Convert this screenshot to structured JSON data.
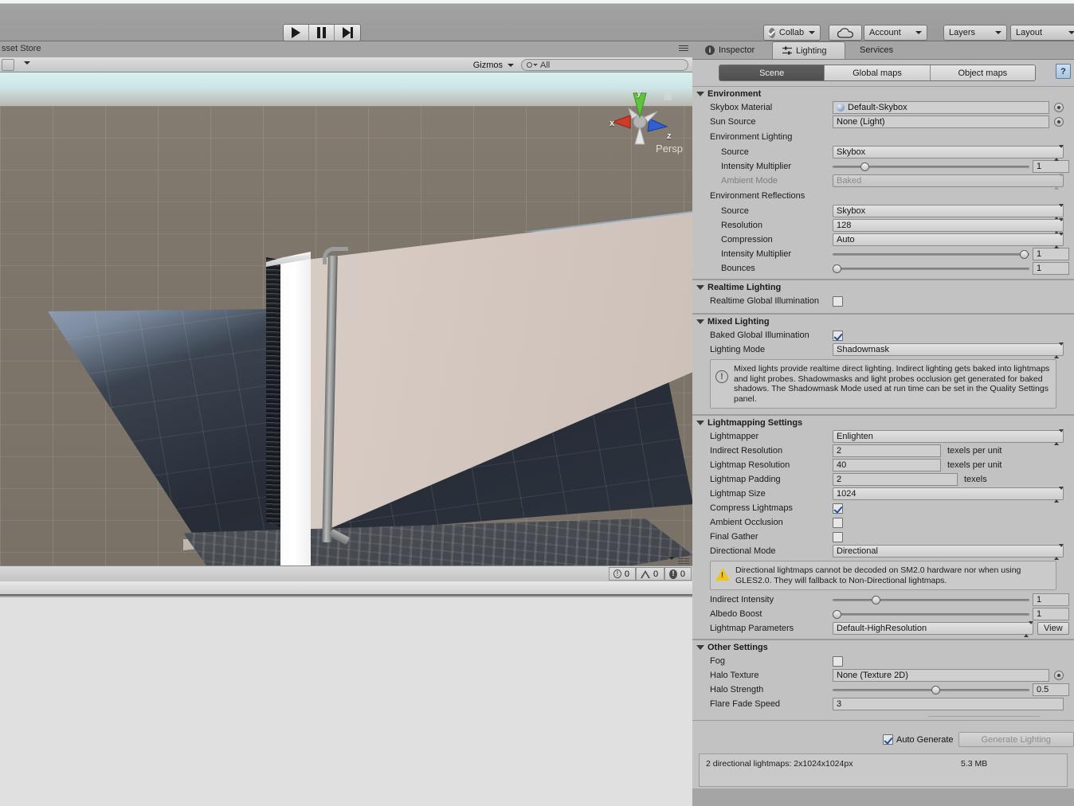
{
  "toolbar": {
    "play_label": "play-icon",
    "pause_label": "pause-icon",
    "step_label": "step-icon",
    "collab": "Collab",
    "cloud": "cloud-icon",
    "account": "Account",
    "layers": "Layers",
    "layout": "Layout"
  },
  "scene_panel": {
    "tab_label": "sset Store",
    "gizmos": "Gizmos",
    "search_value": "All",
    "view_label": "Persp",
    "axis_x": "x",
    "axis_y": "y",
    "axis_z": "z",
    "status": {
      "info_count": "0",
      "warning_count": "0",
      "error_count": "0"
    }
  },
  "inspector": {
    "tabs": [
      {
        "label": "Inspector",
        "icon": "info-icon",
        "active": false
      },
      {
        "label": "Lighting",
        "icon": "lighting-icon",
        "active": true
      },
      {
        "label": "Services",
        "icon": "",
        "active": false
      }
    ],
    "mode_tabs": [
      {
        "label": "Scene",
        "selected": true
      },
      {
        "label": "Global maps",
        "selected": false
      },
      {
        "label": "Object maps",
        "selected": false
      }
    ],
    "help_label": "?"
  },
  "environment": {
    "title": "Environment",
    "skybox_material_label": "Skybox Material",
    "skybox_material_value": "Default-Skybox",
    "sun_source_label": "Sun Source",
    "sun_source_value": "None (Light)",
    "env_lighting_label": "Environment Lighting",
    "source_label": "Source",
    "source_value": "Skybox",
    "intensity_label": "Intensity Multiplier",
    "intensity_value": "1",
    "intensity_pct": 16,
    "ambient_mode_label": "Ambient Mode",
    "ambient_mode_value": "Baked",
    "env_reflections_label": "Environment Reflections",
    "refl_source_label": "Source",
    "refl_source_value": "Skybox",
    "resolution_label": "Resolution",
    "resolution_value": "128",
    "compression_label": "Compression",
    "compression_value": "Auto",
    "refl_intensity_label": "Intensity Multiplier",
    "refl_intensity_value": "1",
    "refl_intensity_pct": 97,
    "bounces_label": "Bounces",
    "bounces_value": "1",
    "bounces_pct": 2
  },
  "realtime_lighting": {
    "title": "Realtime Lighting",
    "rtgi_label": "Realtime Global Illumination",
    "rtgi_checked": false
  },
  "mixed_lighting": {
    "title": "Mixed Lighting",
    "bgi_label": "Baked Global Illumination",
    "bgi_checked": true,
    "lighting_mode_label": "Lighting Mode",
    "lighting_mode_value": "Shadowmask",
    "info_text": "Mixed lights provide realtime direct lighting. Indirect lighting gets baked into lightmaps and light probes. Shadowmasks and light probes occlusion get generated for baked shadows. The Shadowmask Mode used at run time can be set in the Quality Settings panel."
  },
  "lightmapping": {
    "title": "Lightmapping Settings",
    "lightmapper_label": "Lightmapper",
    "lightmapper_value": "Enlighten",
    "indirect_res_label": "Indirect Resolution",
    "indirect_res_value": "2",
    "indirect_res_unit": "texels per unit",
    "lightmap_res_label": "Lightmap Resolution",
    "lightmap_res_value": "40",
    "lightmap_res_unit": "texels per unit",
    "padding_label": "Lightmap Padding",
    "padding_value": "2",
    "padding_unit": "texels",
    "size_label": "Lightmap Size",
    "size_value": "1024",
    "compress_label": "Compress Lightmaps",
    "compress_checked": true,
    "ao_label": "Ambient Occlusion",
    "ao_checked": false,
    "final_gather_label": "Final Gather",
    "final_gather_checked": false,
    "directional_mode_label": "Directional Mode",
    "directional_mode_value": "Directional",
    "warning_text": "Directional lightmaps cannot be decoded on SM2.0 hardware nor when using GLES2.0. They will fallback to Non-Directional lightmaps.",
    "indirect_intensity_label": "Indirect Intensity",
    "indirect_intensity_value": "1",
    "indirect_intensity_pct": 22,
    "albedo_boost_label": "Albedo Boost",
    "albedo_boost_value": "1",
    "albedo_boost_pct": 2,
    "lightmap_params_label": "Lightmap Parameters",
    "lightmap_params_value": "Default-HighResolution",
    "view_button": "View"
  },
  "other_settings": {
    "title": "Other Settings",
    "fog_label": "Fog",
    "fog_checked": false,
    "halo_texture_label": "Halo Texture",
    "halo_texture_value": "None (Texture 2D)",
    "halo_strength_label": "Halo Strength",
    "halo_strength_value": "0.5",
    "halo_strength_pct": 52,
    "flare_fade_label": "Flare Fade Speed",
    "flare_fade_value": "3"
  },
  "generate": {
    "auto_generate_label": "Auto Generate",
    "auto_generate_checked": true,
    "generate_button": "Generate Lighting",
    "stats_left": "2 directional lightmaps: 2x1024x1024px",
    "stats_right": "5.3 MB"
  }
}
